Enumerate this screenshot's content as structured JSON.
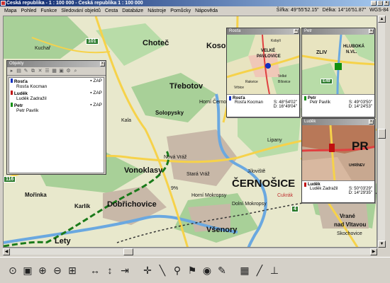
{
  "window": {
    "title": "Česká republika - 1 : 100 000 - Česká republika 1 : 100 000"
  },
  "menu": {
    "items": [
      "Mapa",
      "Pohled",
      "Funkce",
      "Sledování objektů",
      "Cesta",
      "Databáze",
      "Nástroje",
      "Pomůcky",
      "Nápověda"
    ]
  },
  "status": {
    "latitude": "Šířka: 49°55'52.15\"",
    "longitude": "Délka: 14°16'51.87\"",
    "datum": "WGS-84"
  },
  "map": {
    "places": {
      "chotec": "Choteč",
      "kosor": "Kosoř",
      "kuchar": "Kuchař",
      "trebotov": "Třebotov",
      "hornicernosice": "Horní Černošice",
      "solopysky": "Solopysky",
      "kala": "Kala",
      "novavraz": "Nová Vráž",
      "staravraz": "Stará Vráž",
      "vonoklasy": "Vonoklasy",
      "cernosice": "ČERNOŠICE",
      "mokropsy": "Horní Mokropsy",
      "dolnimokropsy": "Dolní Mokropsy",
      "morinka": "Mořinka",
      "karlik": "Karlík",
      "dobrichovice": "Dobřichovice",
      "vsenory": "Všenory",
      "lety": "Lety",
      "lipany": "Lipany",
      "cukrak": "Cukrák",
      "vrane": "Vrané",
      "nadvltavou": "nad Vltavou",
      "skochovice": "Skochovice",
      "jiloviste": "Jíloviště",
      "percent": "9%"
    },
    "road_numbers": {
      "r101": "101",
      "r116": "116",
      "r4": "4"
    }
  },
  "panels": {
    "rosta": {
      "title": "Rosťa",
      "name": "Rosťa",
      "user": "Rosťa Kocman",
      "lat": "S:  48°54'02\"",
      "lon": "D:  16°49'04\"",
      "map_labels": [
        "VELKÉ",
        "PAVLOVICE",
        "Velké",
        "Bílovice",
        "Rakvice",
        "Kobylí",
        "Vrbice"
      ]
    },
    "petr": {
      "title": "Petr",
      "name": "Petr",
      "user": "Petr Pavlík",
      "lat": "S:  49°03'50\"",
      "lon": "D:  14°24'53\"",
      "map_labels": [
        "ZLIV",
        "HLUBOKÁ",
        "N.VL.",
        "E49"
      ]
    },
    "ludek": {
      "title": "Luděk",
      "name": "Luděk",
      "user": "Luděk Zadražil",
      "lat": "S:  50°03'29\"",
      "lon": "D:  14°29'35\"",
      "map_labels": [
        "PR",
        "UHRÍNEV"
      ]
    }
  },
  "objects": {
    "title": "Objekty",
    "items": [
      {
        "name": "Rosťa",
        "user": "Rosťa Kocman",
        "status": "ZAP",
        "color": "#1030c0"
      },
      {
        "name": "Luděk",
        "user": "Luděk Zadražil",
        "status": "ZAP",
        "color": "#c01010"
      },
      {
        "name": "Petr",
        "user": "Petr Pavlík",
        "status": "ZAP",
        "color": "#109010"
      }
    ]
  },
  "toolbar": {
    "tools": [
      "pointer-tool-icon",
      "layers-icon",
      "zoom-in-icon",
      "zoom-out-icon",
      "zoom-extent-icon",
      "pan-horizontal-icon",
      "pan-vertical-icon",
      "move-icon",
      "coordinate-icon",
      "measure-icon",
      "pin-icon",
      "marker-icon",
      "eye-icon",
      "pencil-icon",
      "grid-icon",
      "ruler-icon",
      "tower-icon"
    ]
  },
  "colors": {
    "titlebar": "#0a246a",
    "map_bg": "#e8e8cc",
    "forest": "#a8d098",
    "water": "#6aa8e0",
    "road_yellow": "#f6d24a"
  }
}
